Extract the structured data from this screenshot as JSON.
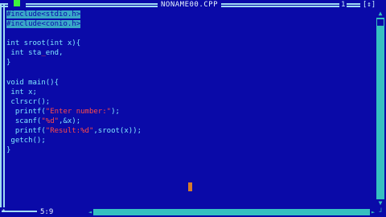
{
  "window": {
    "title": "NONAME00.CPP",
    "close_glyph": "[",
    "window_number": "1",
    "zoom_glyph": "[↕]"
  },
  "editor": {
    "lines": [
      {
        "segments": [
          {
            "t": "#include<stdio.h>",
            "c": "sel"
          }
        ]
      },
      {
        "segments": [
          {
            "t": "#include<conio.h>",
            "c": "sel"
          }
        ]
      },
      {
        "segments": [
          {
            "t": "",
            "c": ""
          }
        ]
      },
      {
        "segments": [
          {
            "t": "int sroot(int x){",
            "c": ""
          }
        ]
      },
      {
        "segments": [
          {
            "t": " int sta",
            "c": ""
          },
          {
            "t": "_",
            "c": "str"
          },
          {
            "t": "end,",
            "c": ""
          }
        ]
      },
      {
        "segments": [
          {
            "t": "}",
            "c": ""
          }
        ]
      },
      {
        "segments": [
          {
            "t": "",
            "c": ""
          }
        ]
      },
      {
        "segments": [
          {
            "t": "void main(){",
            "c": ""
          }
        ]
      },
      {
        "segments": [
          {
            "t": " int x;",
            "c": ""
          }
        ]
      },
      {
        "segments": [
          {
            "t": " clrscr();",
            "c": ""
          }
        ]
      },
      {
        "segments": [
          {
            "t": "  printf(",
            "c": ""
          },
          {
            "t": "\"Enter number:\"",
            "c": "str"
          },
          {
            "t": ");",
            "c": ""
          }
        ]
      },
      {
        "segments": [
          {
            "t": "  scanf(",
            "c": ""
          },
          {
            "t": "\"%d\"",
            "c": "str"
          },
          {
            "t": ",&x);",
            "c": ""
          }
        ]
      },
      {
        "segments": [
          {
            "t": "  printf(",
            "c": ""
          },
          {
            "t": "\"Result:%d\"",
            "c": "str"
          },
          {
            "t": ",sroot(x));",
            "c": ""
          }
        ]
      },
      {
        "segments": [
          {
            "t": " getch();",
            "c": ""
          }
        ]
      },
      {
        "segments": [
          {
            "t": "}",
            "c": ""
          }
        ]
      }
    ]
  },
  "status": {
    "modified_marker": "*",
    "cursor_position": "5:9"
  },
  "scrollbars": {
    "up_glyph": "▲",
    "down_glyph": "▼",
    "left_glyph": "◄",
    "right_glyph": "►",
    "corner_glyph": "┘"
  },
  "colors": {
    "background": "#0a0aa8",
    "text": "#7fe7ff",
    "selection": "#3aa8c8",
    "string": "#ff4a4a",
    "cursor": "#d57b2a",
    "scrollbar": "#35c0c0"
  }
}
